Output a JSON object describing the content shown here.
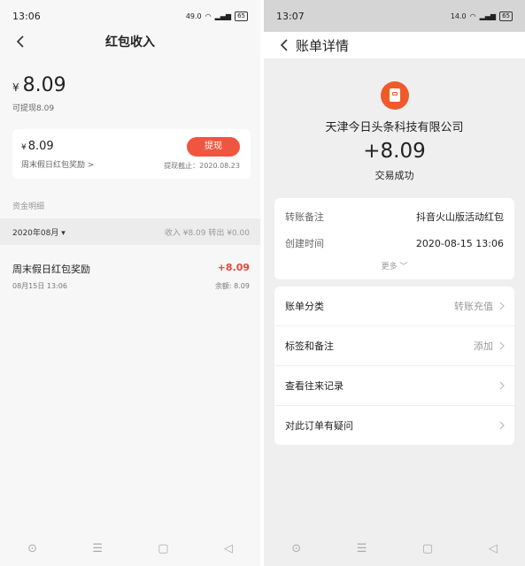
{
  "left": {
    "status": {
      "time": "13:06",
      "net_speed": "49.0",
      "battery": "65"
    },
    "title": "红包收入",
    "balance": {
      "currency": "¥",
      "amount": "8.09",
      "withdrawable": "可提现8.09"
    },
    "reward_card": {
      "currency": "¥",
      "amount": "8.09",
      "name": "周末假日红包奖励 >",
      "withdraw_label": "提现",
      "deadline": "提现截止：2020.08.23"
    },
    "section_label": "资金明细",
    "filter": {
      "month": "2020年08月 ▾",
      "summary": "收入 ¥8.09  转出 ¥0.00"
    },
    "records": [
      {
        "title": "周末假日红包奖励",
        "time": "08月15日 13:06",
        "amount": "+8.09",
        "balance": "余额: 8.09"
      }
    ]
  },
  "right": {
    "status": {
      "time": "13:07",
      "net_speed": "14.0",
      "battery": "65"
    },
    "title": "账单详情",
    "icon": "red-envelope-icon",
    "company": "天津今日头条科技有限公司",
    "amount": "+8.09",
    "txn_status": "交易成功",
    "info_rows": [
      {
        "key": "转账备注",
        "value": "抖音火山版活动红包"
      },
      {
        "key": "创建时间",
        "value": "2020-08-15 13:06"
      }
    ],
    "more_label": "更多 ﹀",
    "menu_rows": [
      {
        "label": "账单分类",
        "value": "转账充值"
      },
      {
        "label": "标签和备注",
        "value": "添加"
      },
      {
        "label": "查看往来记录",
        "value": ""
      },
      {
        "label": "对此订单有疑问",
        "value": ""
      }
    ]
  },
  "sysnav": {
    "home_glyph": "⊙",
    "menu_glyph": "☰",
    "recent_glyph": "▢",
    "back_glyph": "◁"
  }
}
